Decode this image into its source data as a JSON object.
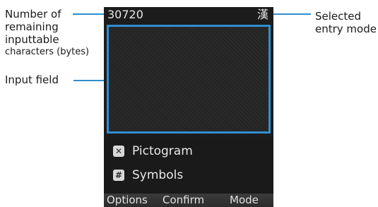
{
  "annotations": {
    "remaining_line1": "Number of",
    "remaining_line2": "remaining",
    "remaining_line3": "inputtable",
    "remaining_line4": "characters (bytes)",
    "input_field": "Input field",
    "mode_line1": "Selected",
    "mode_line2": "entry mode"
  },
  "status_bar": {
    "remaining_count": "30720",
    "entry_mode": "漢"
  },
  "menu": {
    "items": [
      {
        "key_icon": "x-key-icon",
        "key_glyph": "✕",
        "label": "Pictogram"
      },
      {
        "key_icon": "hash-key-icon",
        "key_glyph": "#",
        "label": "Symbols"
      }
    ]
  },
  "softkeys": {
    "left": "Options",
    "center": "Confirm",
    "right": "Mode"
  },
  "colors": {
    "leader": "#2f8fd0",
    "screen_bg": "#1c1c1c",
    "input_border": "#2f8fd0"
  }
}
